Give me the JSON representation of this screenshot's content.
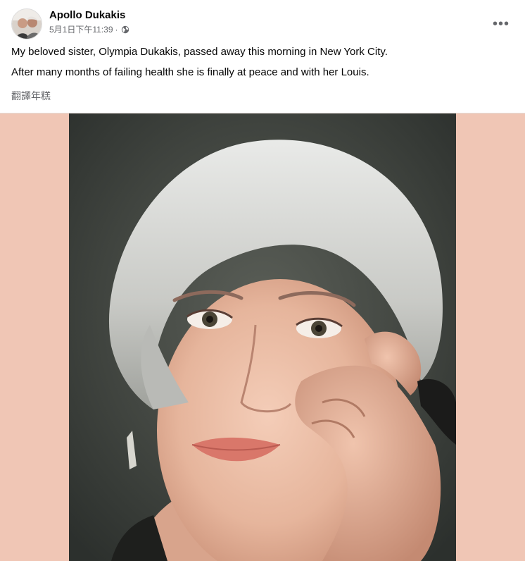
{
  "post": {
    "author": "Apollo Dukakis",
    "timestamp": "5月1日下午11:39",
    "privacy_separator": "·",
    "privacy_icon": "globe-icon",
    "more_icon": "more-options-icon",
    "more_label": "•••",
    "text_lines": [
      "My beloved sister, Olympia Dukakis, passed away this morning in New York City.",
      "After many months of failing health she is finally at peace and with her Louis."
    ],
    "translate_label": "翻譯年糕"
  },
  "colors": {
    "photo_background": "#f0c6b5",
    "secondary_text": "#65676b",
    "primary_text": "#050505"
  }
}
